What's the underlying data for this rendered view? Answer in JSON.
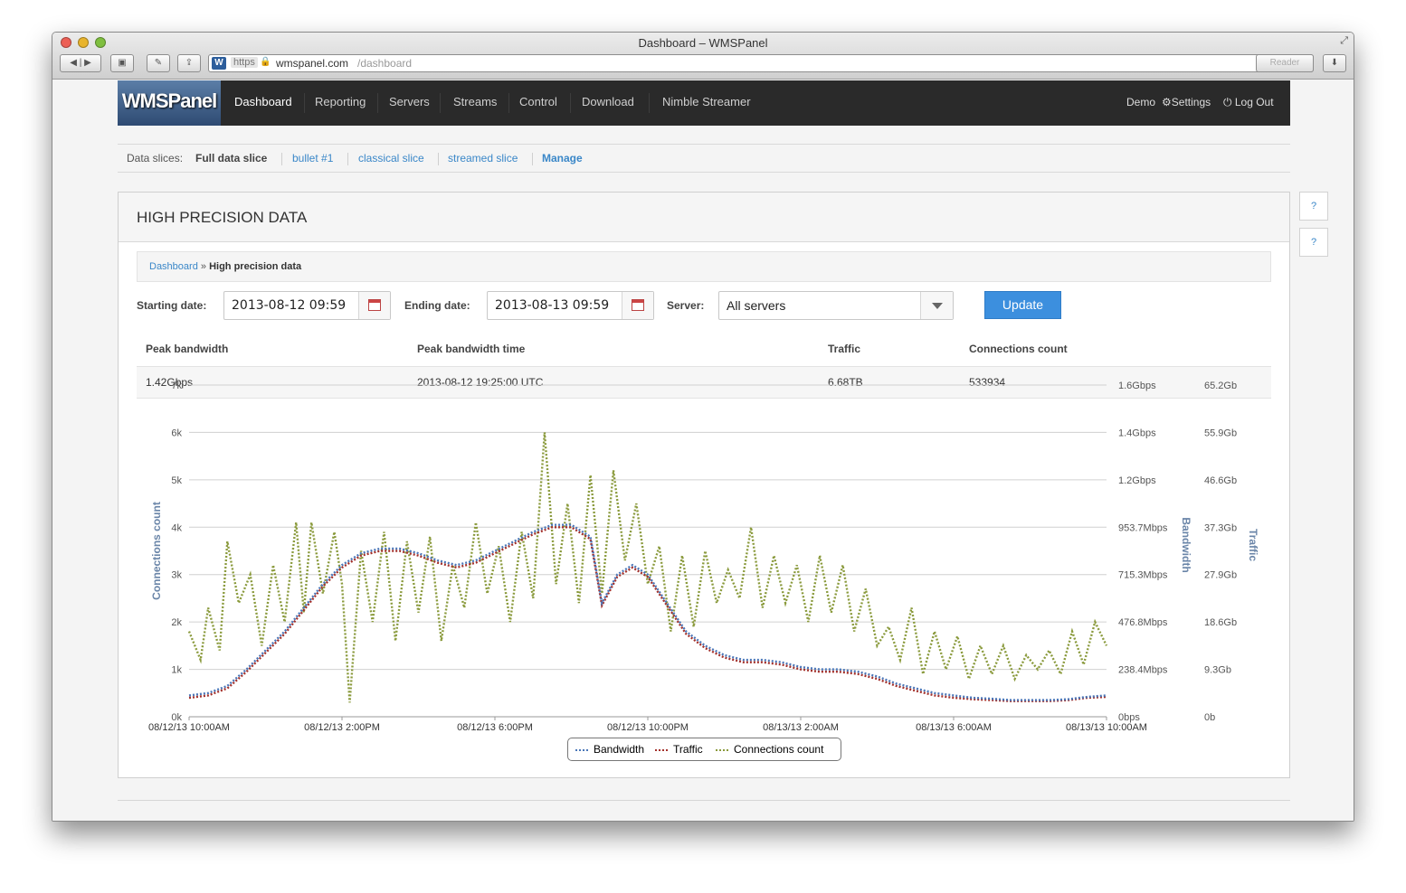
{
  "window": {
    "title": "Dashboard – WMSPanel"
  },
  "browser": {
    "url_scheme": "https",
    "url_host": "wmspanel.com",
    "url_path": "/dashboard",
    "favicon": "W",
    "reader_label": "Reader",
    "icons": [
      "back-icon",
      "forward-icon",
      "screenshot-icon",
      "tools-icon",
      "share-icon",
      "lock-icon",
      "reload-icon",
      "download-icon",
      "fullscreen-icon"
    ]
  },
  "nav": {
    "logo": "WMSPanel",
    "items": [
      "Dashboard",
      "Reporting",
      "Servers",
      "Streams",
      "Control",
      "Download",
      "Nimble Streamer"
    ],
    "active": "Dashboard",
    "user": "Demo",
    "settings": "Settings",
    "logout": "Log Out"
  },
  "slices": {
    "label": "Data slices:",
    "current": "Full data slice",
    "links": [
      "bullet #1",
      "classical slice",
      "streamed slice"
    ],
    "manage": "Manage"
  },
  "panel": {
    "title": "HIGH PRECISION DATA",
    "help_buttons": [
      "?",
      "?"
    ],
    "breadcrumb": {
      "home": "Dashboard",
      "sep": "»",
      "current": "High precision data"
    }
  },
  "filters": {
    "start_label": "Starting date:",
    "start_value": "2013-08-12 09:59",
    "end_label": "Ending date:",
    "end_value": "2013-08-13 09:59",
    "server_label": "Server:",
    "server_value": "All servers",
    "update_label": "Update"
  },
  "stats": {
    "headers": [
      "Peak bandwidth",
      "Peak bandwidth time",
      "Traffic",
      "Connections count"
    ],
    "values": [
      "1.42Gbps",
      "2013-08-12 19:25:00 UTC",
      "6.68TB",
      "533934"
    ]
  },
  "chart_data": {
    "type": "line",
    "x_ticks": [
      "08/12/13 10:00AM",
      "08/12/13 2:00PM",
      "08/12/13 6:00PM",
      "08/12/13 10:00PM",
      "08/13/13 2:00AM",
      "08/13/13 6:00AM",
      "08/13/13 10:00AM"
    ],
    "y_left": {
      "label": "Connections count",
      "ticks": [
        "0k",
        "1k",
        "2k",
        "3k",
        "4k",
        "5k",
        "6k",
        "7k"
      ],
      "range": [
        0,
        7000
      ]
    },
    "y_bandwidth": {
      "label": "Bandwidth",
      "ticks": [
        "0bps",
        "238.4Mbps",
        "476.8Mbps",
        "715.3Mbps",
        "953.7Mbps",
        "1.2Gbps",
        "1.4Gbps",
        "1.6Gbps"
      ]
    },
    "y_traffic": {
      "label": "Traffic",
      "ticks": [
        "0b",
        "9.3Gb",
        "18.6Gb",
        "27.9Gb",
        "37.3Gb",
        "46.6Gb",
        "55.9Gb",
        "65.2Gb"
      ]
    },
    "x_range_hours": [
      0,
      24
    ],
    "grid": true,
    "legend_position": "bottom-center",
    "series": [
      {
        "name": "Bandwidth",
        "color": "#4a76b8",
        "points": [
          [
            0,
            0.45
          ],
          [
            0.5,
            0.5
          ],
          [
            1,
            0.65
          ],
          [
            1.5,
            1.0
          ],
          [
            2,
            1.4
          ],
          [
            2.5,
            1.8
          ],
          [
            3,
            2.3
          ],
          [
            3.5,
            2.8
          ],
          [
            4,
            3.2
          ],
          [
            4.5,
            3.45
          ],
          [
            5,
            3.55
          ],
          [
            5.5,
            3.55
          ],
          [
            6,
            3.45
          ],
          [
            6.5,
            3.3
          ],
          [
            7,
            3.2
          ],
          [
            7.5,
            3.3
          ],
          [
            8,
            3.5
          ],
          [
            8.5,
            3.7
          ],
          [
            9,
            3.9
          ],
          [
            9.5,
            4.05
          ],
          [
            10,
            4.05
          ],
          [
            10.5,
            3.8
          ],
          [
            10.8,
            2.4
          ],
          [
            11.2,
            3.0
          ],
          [
            11.6,
            3.2
          ],
          [
            12,
            3.0
          ],
          [
            12.5,
            2.4
          ],
          [
            13,
            1.8
          ],
          [
            13.5,
            1.5
          ],
          [
            14,
            1.3
          ],
          [
            14.5,
            1.2
          ],
          [
            15,
            1.2
          ],
          [
            15.5,
            1.15
          ],
          [
            16,
            1.05
          ],
          [
            16.5,
            1.0
          ],
          [
            17,
            1.0
          ],
          [
            17.5,
            0.95
          ],
          [
            18,
            0.85
          ],
          [
            18.5,
            0.7
          ],
          [
            19,
            0.6
          ],
          [
            19.5,
            0.5
          ],
          [
            20,
            0.45
          ],
          [
            20.5,
            0.4
          ],
          [
            21,
            0.38
          ],
          [
            21.5,
            0.35
          ],
          [
            22,
            0.35
          ],
          [
            22.5,
            0.35
          ],
          [
            23,
            0.37
          ],
          [
            23.5,
            0.42
          ],
          [
            24,
            0.45
          ]
        ]
      },
      {
        "name": "Traffic",
        "color": "#a3302b",
        "points": [
          [
            0,
            0.4
          ],
          [
            0.5,
            0.45
          ],
          [
            1,
            0.6
          ],
          [
            1.5,
            0.95
          ],
          [
            2,
            1.35
          ],
          [
            2.5,
            1.75
          ],
          [
            3,
            2.25
          ],
          [
            3.5,
            2.75
          ],
          [
            4,
            3.15
          ],
          [
            4.5,
            3.4
          ],
          [
            5,
            3.5
          ],
          [
            5.5,
            3.5
          ],
          [
            6,
            3.4
          ],
          [
            6.5,
            3.25
          ],
          [
            7,
            3.15
          ],
          [
            7.5,
            3.25
          ],
          [
            8,
            3.45
          ],
          [
            8.5,
            3.65
          ],
          [
            9,
            3.85
          ],
          [
            9.5,
            4.0
          ],
          [
            10,
            4.0
          ],
          [
            10.5,
            3.75
          ],
          [
            10.8,
            2.35
          ],
          [
            11.2,
            2.95
          ],
          [
            11.6,
            3.15
          ],
          [
            12,
            2.95
          ],
          [
            12.5,
            2.35
          ],
          [
            13,
            1.75
          ],
          [
            13.5,
            1.45
          ],
          [
            14,
            1.25
          ],
          [
            14.5,
            1.15
          ],
          [
            15,
            1.15
          ],
          [
            15.5,
            1.1
          ],
          [
            16,
            1.0
          ],
          [
            16.5,
            0.95
          ],
          [
            17,
            0.95
          ],
          [
            17.5,
            0.9
          ],
          [
            18,
            0.8
          ],
          [
            18.5,
            0.65
          ],
          [
            19,
            0.55
          ],
          [
            19.5,
            0.45
          ],
          [
            20,
            0.4
          ],
          [
            20.5,
            0.37
          ],
          [
            21,
            0.35
          ],
          [
            21.5,
            0.33
          ],
          [
            22,
            0.33
          ],
          [
            22.5,
            0.33
          ],
          [
            23,
            0.35
          ],
          [
            23.5,
            0.4
          ],
          [
            24,
            0.42
          ]
        ]
      },
      {
        "name": "Connections count",
        "color": "#8a9a3c",
        "points": [
          [
            0,
            1.8
          ],
          [
            0.3,
            1.2
          ],
          [
            0.5,
            2.3
          ],
          [
            0.8,
            1.4
          ],
          [
            1,
            3.7
          ],
          [
            1.3,
            2.4
          ],
          [
            1.6,
            3.0
          ],
          [
            1.9,
            1.5
          ],
          [
            2.2,
            3.2
          ],
          [
            2.5,
            2.0
          ],
          [
            2.8,
            4.1
          ],
          [
            3.0,
            2.2
          ],
          [
            3.2,
            4.1
          ],
          [
            3.5,
            2.6
          ],
          [
            3.8,
            3.9
          ],
          [
            4.0,
            2.8
          ],
          [
            4.2,
            0.3
          ],
          [
            4.5,
            3.5
          ],
          [
            4.8,
            2.0
          ],
          [
            5.1,
            3.9
          ],
          [
            5.4,
            1.6
          ],
          [
            5.7,
            3.7
          ],
          [
            6.0,
            2.2
          ],
          [
            6.3,
            3.8
          ],
          [
            6.6,
            1.6
          ],
          [
            6.9,
            3.2
          ],
          [
            7.2,
            2.3
          ],
          [
            7.5,
            4.1
          ],
          [
            7.8,
            2.6
          ],
          [
            8.1,
            3.6
          ],
          [
            8.4,
            2.0
          ],
          [
            8.7,
            3.9
          ],
          [
            9.0,
            2.5
          ],
          [
            9.3,
            6.0
          ],
          [
            9.6,
            2.8
          ],
          [
            9.9,
            4.5
          ],
          [
            10.2,
            2.4
          ],
          [
            10.5,
            5.1
          ],
          [
            10.8,
            2.6
          ],
          [
            11.1,
            5.2
          ],
          [
            11.4,
            3.3
          ],
          [
            11.7,
            4.5
          ],
          [
            12.0,
            2.8
          ],
          [
            12.3,
            3.6
          ],
          [
            12.6,
            1.8
          ],
          [
            12.9,
            3.4
          ],
          [
            13.2,
            1.9
          ],
          [
            13.5,
            3.5
          ],
          [
            13.8,
            2.4
          ],
          [
            14.1,
            3.1
          ],
          [
            14.4,
            2.5
          ],
          [
            14.7,
            4.0
          ],
          [
            15.0,
            2.3
          ],
          [
            15.3,
            3.4
          ],
          [
            15.6,
            2.4
          ],
          [
            15.9,
            3.2
          ],
          [
            16.2,
            2.0
          ],
          [
            16.5,
            3.4
          ],
          [
            16.8,
            2.2
          ],
          [
            17.1,
            3.2
          ],
          [
            17.4,
            1.8
          ],
          [
            17.7,
            2.7
          ],
          [
            18.0,
            1.5
          ],
          [
            18.3,
            1.9
          ],
          [
            18.6,
            1.2
          ],
          [
            18.9,
            2.3
          ],
          [
            19.2,
            0.9
          ],
          [
            19.5,
            1.8
          ],
          [
            19.8,
            1.0
          ],
          [
            20.1,
            1.7
          ],
          [
            20.4,
            0.8
          ],
          [
            20.7,
            1.5
          ],
          [
            21.0,
            0.9
          ],
          [
            21.3,
            1.5
          ],
          [
            21.6,
            0.8
          ],
          [
            21.9,
            1.3
          ],
          [
            22.2,
            1.0
          ],
          [
            22.5,
            1.4
          ],
          [
            22.8,
            0.9
          ],
          [
            23.1,
            1.8
          ],
          [
            23.4,
            1.1
          ],
          [
            23.7,
            2.0
          ],
          [
            24,
            1.5
          ]
        ]
      }
    ]
  }
}
